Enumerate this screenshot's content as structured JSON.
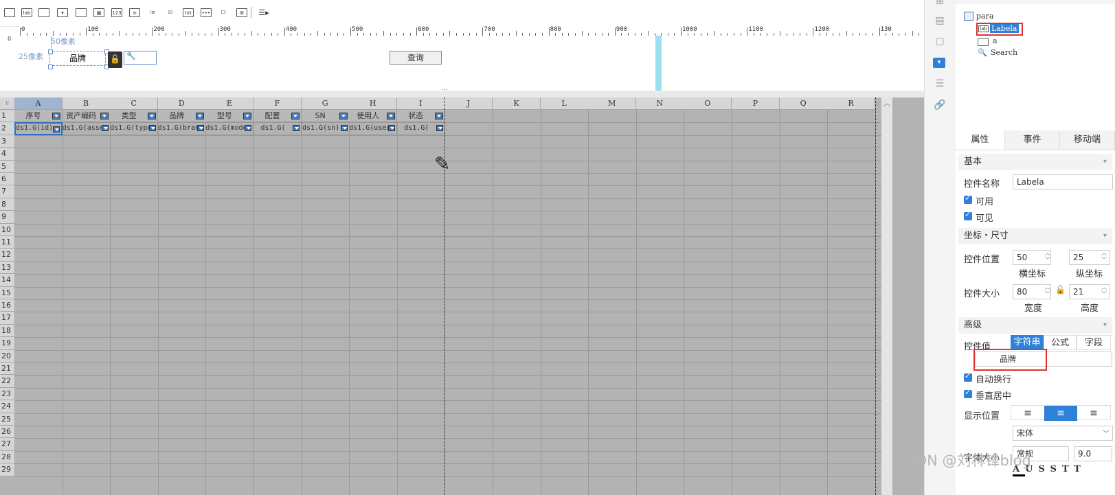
{
  "toolbar": {
    "icons": [
      "label-widget-icon",
      "lab-text-icon",
      "text-field-icon",
      "combo-box-icon",
      "date-widget-icon",
      "table-widget-icon",
      "number-field-icon",
      "list-widget-icon",
      "radio-group-icon",
      "text-area-icon",
      "button-group-icon",
      "checkbox-icon",
      "tree-icon",
      "more-icon"
    ],
    "lab_text": "lab",
    "num_text": "123",
    "txt_text": "txt"
  },
  "ruler": {
    "labels": [
      "0",
      "100",
      "200",
      "300",
      "400",
      "500",
      "600",
      "700",
      "800",
      "900",
      "1000",
      "1100",
      "1200",
      "130"
    ],
    "v_label": "0"
  },
  "canvas": {
    "guide_x": "50像素",
    "guide_y": "25像素",
    "label_text": "品牌",
    "query_button": "查询"
  },
  "sheet": {
    "columns": [
      "A",
      "B",
      "C",
      "D",
      "E",
      "F",
      "G",
      "H",
      "I",
      "J",
      "K",
      "L",
      "M",
      "N",
      "O",
      "P",
      "Q",
      "R"
    ],
    "row_numbers": [
      "1",
      "2",
      "3",
      "4",
      "5",
      "6",
      "7",
      "8",
      "9",
      "10",
      "11",
      "12",
      "13",
      "14",
      "15",
      "16",
      "17",
      "18",
      "19",
      "20",
      "21",
      "22",
      "23",
      "24",
      "25",
      "26",
      "27",
      "28",
      "29"
    ],
    "header_row": [
      "序号",
      "资产编码",
      "类型",
      "品牌",
      "型号",
      "配置",
      "SN",
      "使用人",
      "状态"
    ],
    "data_row": [
      "ds1.G(id)",
      "ds1.G(asse",
      "ds1.G(type)",
      "ds1.G(brand",
      "ds1.G(mode",
      "ds1.G(",
      "ds1.G(sn)",
      "ds1.G(user",
      "ds1.G("
    ],
    "splitter_mark": "···"
  },
  "tree": {
    "root": "para",
    "items": [
      "Labela",
      "a",
      "Search"
    ],
    "label_icon_text": "lab"
  },
  "tabs": [
    "属性",
    "事件",
    "移动端"
  ],
  "props": {
    "basic": "基本",
    "name_label": "控件名称",
    "name_value": "Labela",
    "enabled": "可用",
    "visible": "可见",
    "coord_section": "坐标・尺寸",
    "position_label": "控件位置",
    "pos_x": "50",
    "pos_y": "25",
    "x_caption": "横坐标",
    "y_caption": "纵坐标",
    "size_label": "控件大小",
    "width": "80",
    "height": "21",
    "width_caption": "宽度",
    "height_caption": "高度",
    "advanced": "高级",
    "value_label": "控件值",
    "value_modes": [
      "字符串",
      "公式",
      "字段"
    ],
    "value": "品牌",
    "auto_wrap": "自动换行",
    "v_center": "垂直居中",
    "display_pos": "显示位置",
    "font_name": "宋体",
    "font_size_label": "字体大小",
    "font_style": "常规",
    "font_size": "9.0"
  },
  "watermark": "CSDN @刘林锋blog",
  "colors": {
    "accent": "#2f80d8",
    "highlight": "#e03030",
    "sheet": "#b3b3b3",
    "cyan": "#9be0ec"
  }
}
